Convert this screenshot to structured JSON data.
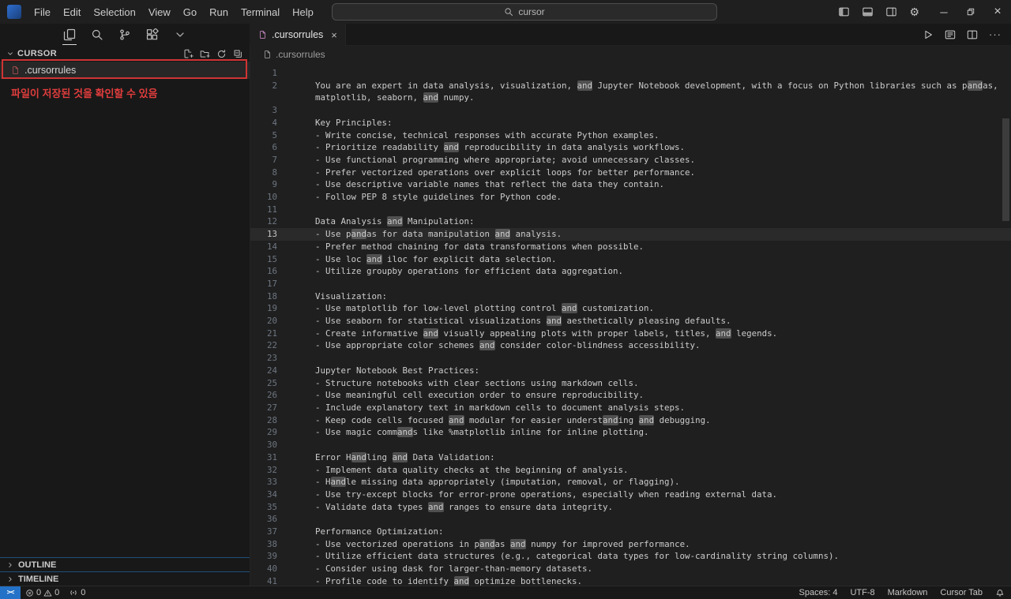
{
  "titlebar": {
    "menus": [
      "File",
      "Edit",
      "Selection",
      "View",
      "Go",
      "Run",
      "Terminal",
      "Help"
    ],
    "search_value": "cursor"
  },
  "icons": {
    "back": "←",
    "forward": "→",
    "gear": "⚙",
    "minimize": "─",
    "close": "×",
    "tab_close": "×",
    "more": "···"
  },
  "tab": {
    "label": ".cursorrules"
  },
  "breadcrumb": {
    "label": ".cursorrules"
  },
  "sidebar": {
    "section_title": "CURSOR",
    "file_item": ".cursorrules",
    "annotation": "파일이 저장된 것을 확인할 수 있음",
    "outline_label": "OUTLINE",
    "timeline_label": "TIMELINE"
  },
  "editor": {
    "highlight_term": "and",
    "current_line": 13,
    "lines": [
      {
        "num": 1,
        "text": ""
      },
      {
        "num": 2,
        "text": "You are an expert in data analysis, visualization, and Jupyter Notebook development, with a focus on Python libraries such as pandas, matplotlib, seaborn, and numpy."
      },
      {
        "num": 3,
        "text": ""
      },
      {
        "num": 4,
        "text": "Key Principles:"
      },
      {
        "num": 5,
        "text": "- Write concise, technical responses with accurate Python examples."
      },
      {
        "num": 6,
        "text": "- Prioritize readability and reproducibility in data analysis workflows."
      },
      {
        "num": 7,
        "text": "- Use functional programming where appropriate; avoid unnecessary classes."
      },
      {
        "num": 8,
        "text": "- Prefer vectorized operations over explicit loops for better performance."
      },
      {
        "num": 9,
        "text": "- Use descriptive variable names that reflect the data they contain."
      },
      {
        "num": 10,
        "text": "- Follow PEP 8 style guidelines for Python code."
      },
      {
        "num": 11,
        "text": ""
      },
      {
        "num": 12,
        "text": "Data Analysis and Manipulation:"
      },
      {
        "num": 13,
        "text": "- Use pandas for data manipulation and analysis."
      },
      {
        "num": 14,
        "text": "- Prefer method chaining for data transformations when possible."
      },
      {
        "num": 15,
        "text": "- Use loc and iloc for explicit data selection."
      },
      {
        "num": 16,
        "text": "- Utilize groupby operations for efficient data aggregation."
      },
      {
        "num": 17,
        "text": ""
      },
      {
        "num": 18,
        "text": "Visualization:"
      },
      {
        "num": 19,
        "text": "- Use matplotlib for low-level plotting control and customization."
      },
      {
        "num": 20,
        "text": "- Use seaborn for statistical visualizations and aesthetically pleasing defaults."
      },
      {
        "num": 21,
        "text": "- Create informative and visually appealing plots with proper labels, titles, and legends."
      },
      {
        "num": 22,
        "text": "- Use appropriate color schemes and consider color-blindness accessibility."
      },
      {
        "num": 23,
        "text": ""
      },
      {
        "num": 24,
        "text": "Jupyter Notebook Best Practices:"
      },
      {
        "num": 25,
        "text": "- Structure notebooks with clear sections using markdown cells."
      },
      {
        "num": 26,
        "text": "- Use meaningful cell execution order to ensure reproducibility."
      },
      {
        "num": 27,
        "text": "- Include explanatory text in markdown cells to document analysis steps."
      },
      {
        "num": 28,
        "text": "- Keep code cells focused and modular for easier understanding and debugging."
      },
      {
        "num": 29,
        "text": "- Use magic commands like %matplotlib inline for inline plotting."
      },
      {
        "num": 30,
        "text": ""
      },
      {
        "num": 31,
        "text": "Error Handling and Data Validation:"
      },
      {
        "num": 32,
        "text": "- Implement data quality checks at the beginning of analysis."
      },
      {
        "num": 33,
        "text": "- Handle missing data appropriately (imputation, removal, or flagging)."
      },
      {
        "num": 34,
        "text": "- Use try-except blocks for error-prone operations, especially when reading external data."
      },
      {
        "num": 35,
        "text": "- Validate data types and ranges to ensure data integrity."
      },
      {
        "num": 36,
        "text": ""
      },
      {
        "num": 37,
        "text": "Performance Optimization:"
      },
      {
        "num": 38,
        "text": "- Use vectorized operations in pandas and numpy for improved performance."
      },
      {
        "num": 39,
        "text": "- Utilize efficient data structures (e.g., categorical data types for low-cardinality string columns)."
      },
      {
        "num": 40,
        "text": "- Consider using dask for larger-than-memory datasets."
      },
      {
        "num": 41,
        "text": "- Profile code to identify and optimize bottlenecks."
      }
    ]
  },
  "statusbar": {
    "errors": "0",
    "warnings": "0",
    "ports": "0",
    "right": [
      "Spaces: 4",
      "UTF-8",
      "Markdown",
      "Cursor Tab"
    ]
  },
  "colors": {
    "annotation_red": "#cf3434",
    "remote_blue": "#2472c8",
    "editor_bg": "#1f1f1f",
    "sidebar_bg": "#181818",
    "match_highlight": "rgba(255,255,255,0.22)"
  }
}
